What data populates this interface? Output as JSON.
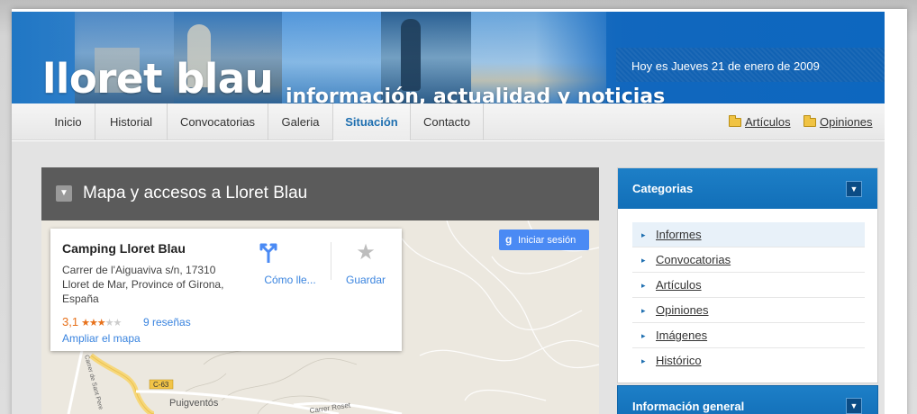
{
  "header": {
    "site_title": "lloret blau",
    "tagline": "información, actualidad y noticias",
    "date_text": "Hoy es Jueves 21 de enero de 2009"
  },
  "nav": {
    "items": [
      {
        "label": "Inicio"
      },
      {
        "label": "Historial"
      },
      {
        "label": "Convocatorias"
      },
      {
        "label": "Galeria"
      },
      {
        "label": "Situación",
        "active": true
      },
      {
        "label": "Contacto"
      }
    ],
    "right_links": [
      {
        "label": "Artículos",
        "icon": "folder-icon"
      },
      {
        "label": "Opiniones",
        "icon": "folder-icon"
      }
    ]
  },
  "map_panel": {
    "title": "Mapa y accesos a Lloret Blau",
    "toggle_icon": "chevron-down-icon",
    "place": {
      "name": "Camping Lloret Blau",
      "address": "Carrer de l'Aiguaviva s/n, 17310 Lloret de Mar, Province of Girona, España",
      "rating": "3,1",
      "stars": "★★★★★",
      "reviews": "9 reseñas",
      "enlarge": "Ampliar el mapa",
      "directions_label": "Cómo lle...",
      "save_label": "Guardar"
    },
    "signin": {
      "g": "g",
      "label": "Iniciar sesión"
    },
    "map_labels": {
      "road_c63": "C-63",
      "town": "Puigventós",
      "street1": "Carrer Roset",
      "street2": "Carrer de Sant Pere"
    }
  },
  "sidebar": {
    "categories_title": "Categorias",
    "categories": [
      {
        "label": "Informes",
        "highlight": true
      },
      {
        "label": "Convocatorias"
      },
      {
        "label": "Artículos"
      },
      {
        "label": "Opiniones"
      },
      {
        "label": "Imágenes"
      },
      {
        "label": "Histórico"
      }
    ],
    "info_title": "Información general"
  },
  "colors": {
    "banner_blue": "#1f76c4",
    "active_nav": "#1e6fb0",
    "map_header": "#5b5b5b",
    "link_blue": "#3a84df",
    "rating_orange": "#e7711b"
  }
}
